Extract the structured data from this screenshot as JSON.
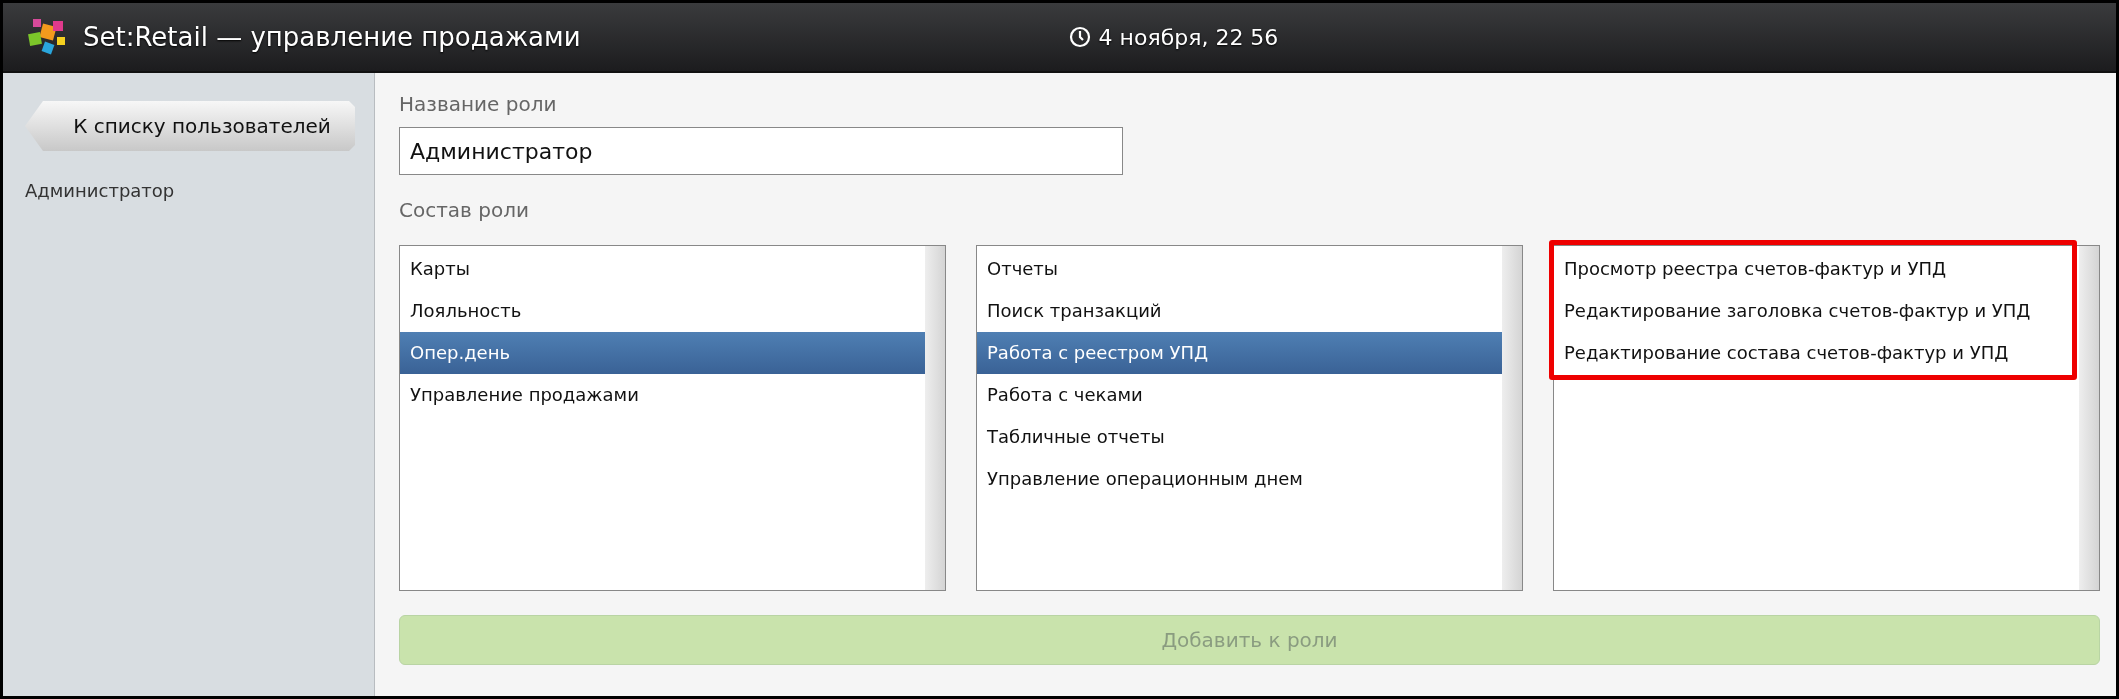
{
  "header": {
    "title": "Set:Retail — управление продажами",
    "datetime": "4 ноября, 22 56"
  },
  "sidebar": {
    "back_button": "К списку пользователей",
    "user": "Администратор"
  },
  "role_name": {
    "label": "Название роли",
    "value": "Администратор"
  },
  "role_composition": {
    "label": "Состав роли"
  },
  "lists": [
    {
      "highlighted": false,
      "items": [
        {
          "label": "Карты",
          "selected": false
        },
        {
          "label": "Лояльность",
          "selected": false
        },
        {
          "label": "Опер.день",
          "selected": true
        },
        {
          "label": "Управление продажами",
          "selected": false
        }
      ]
    },
    {
      "highlighted": false,
      "items": [
        {
          "label": "Отчеты",
          "selected": false
        },
        {
          "label": "Поиск транзакций",
          "selected": false
        },
        {
          "label": "Работа с реестром УПД",
          "selected": true
        },
        {
          "label": "Работа с чеками",
          "selected": false
        },
        {
          "label": "Табличные отчеты",
          "selected": false
        },
        {
          "label": "Управление операционным днем",
          "selected": false
        }
      ]
    },
    {
      "highlighted": true,
      "items": [
        {
          "label": "Просмотр реестра счетов-фактур и УПД",
          "selected": false
        },
        {
          "label": "Редактирование заголовка счетов-фактур и УПД",
          "selected": false
        },
        {
          "label": "Редактирование состава счетов-фактур и УПД",
          "selected": false
        }
      ]
    }
  ],
  "add_button": {
    "label": "Добавить к роли",
    "disabled": true
  }
}
